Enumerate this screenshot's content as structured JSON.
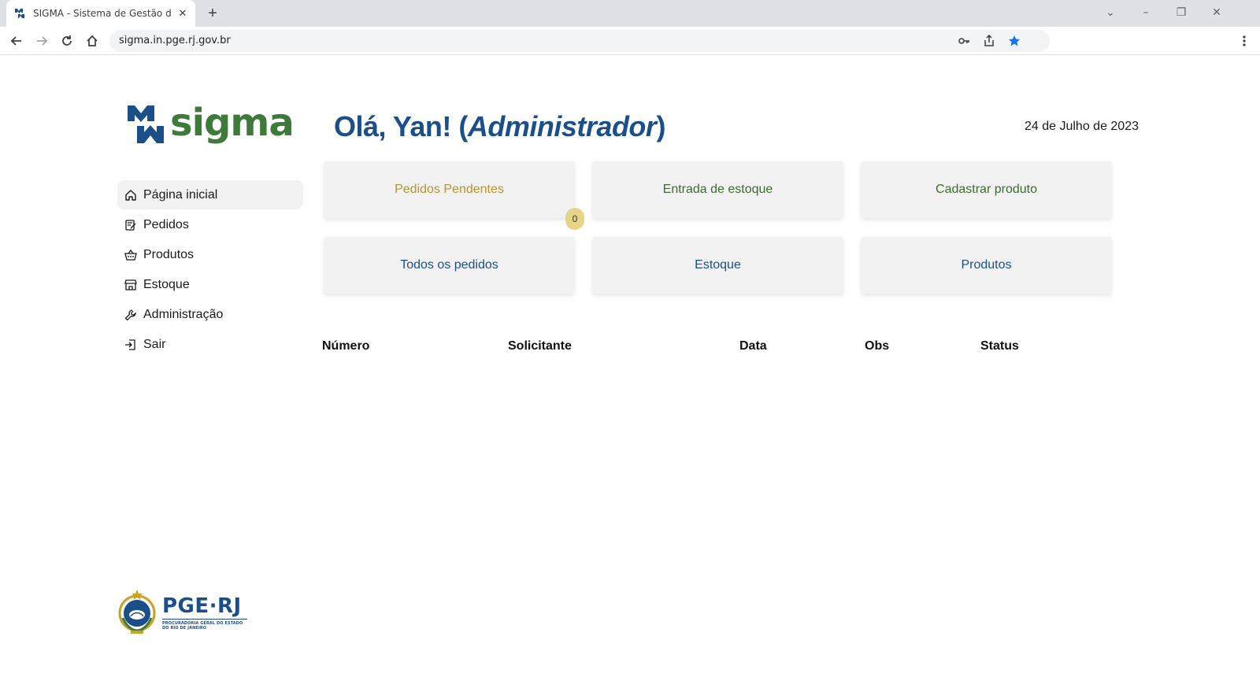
{
  "browser": {
    "tab_title": "SIGMA - Sistema de Gestão de M",
    "url": "sigma.in.pge.rj.gov.br"
  },
  "app": {
    "logo_text": "sigma",
    "greeting_prefix": "Olá, Yan! (",
    "greeting_role": "Administrador",
    "greeting_suffix": ")",
    "date": "24 de Julho de 2023"
  },
  "sidebar": {
    "items": [
      {
        "label": "Página inicial",
        "icon": "home-icon"
      },
      {
        "label": "Pedidos",
        "icon": "edit-note-icon"
      },
      {
        "label": "Produtos",
        "icon": "basket-icon"
      },
      {
        "label": "Estoque",
        "icon": "store-icon"
      },
      {
        "label": "Administração",
        "icon": "wrench-icon"
      },
      {
        "label": "Sair",
        "icon": "logout-icon"
      }
    ]
  },
  "cards": [
    {
      "label": "Pedidos Pendentes",
      "color": "#b7942f"
    },
    {
      "label": "Entrada de estoque",
      "color": "#3e6b2f"
    },
    {
      "label": "Cadastrar produto",
      "color": "#3e6b2f"
    },
    {
      "label": "Todos os pedidos",
      "color": "#1b4f8a"
    },
    {
      "label": "Estoque",
      "color": "#1b4f8a"
    },
    {
      "label": "Produtos",
      "color": "#1b4f8a"
    }
  ],
  "pending_badge": "0",
  "table": {
    "headers": [
      "Número",
      "Solicitante",
      "Data",
      "Obs",
      "Status"
    ]
  },
  "footer": {
    "org_title": "PGE·RJ",
    "org_sub_1": "PROCURADORIA GERAL DO ESTADO",
    "org_sub_2": "DO RIO DE JANEIRO"
  },
  "colors": {
    "brand_blue": "#1b4f8a",
    "brand_green": "#3e7a39",
    "badge": "#e6d589"
  }
}
